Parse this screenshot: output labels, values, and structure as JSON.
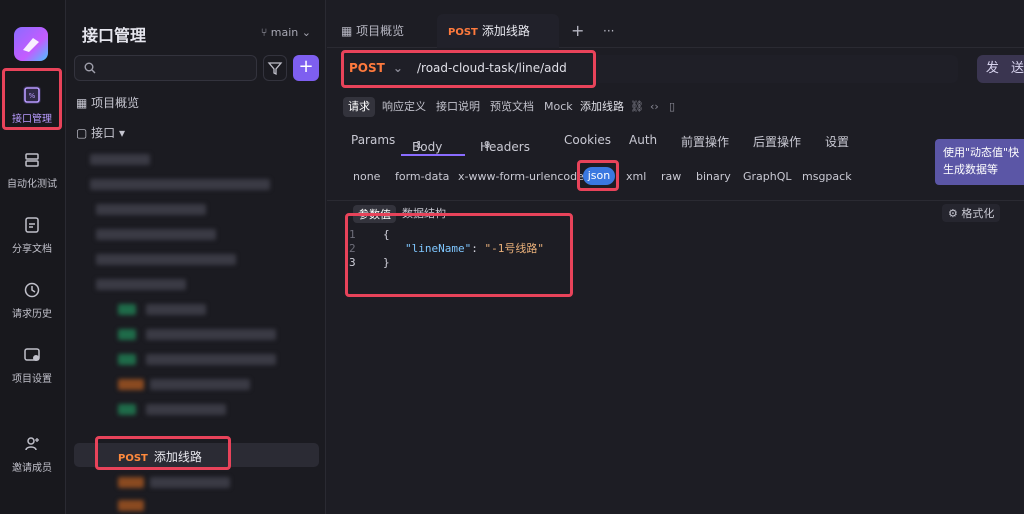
{
  "rail": {
    "items": [
      {
        "label": "接口管理",
        "icon": "api-doc-icon"
      },
      {
        "label": "自动化测试",
        "icon": "automation-icon"
      },
      {
        "label": "分享文档",
        "icon": "share-doc-icon"
      },
      {
        "label": "请求历史",
        "icon": "history-icon"
      },
      {
        "label": "项目设置",
        "icon": "settings-icon"
      },
      {
        "label": "邀请成员",
        "icon": "invite-user-icon"
      }
    ]
  },
  "tree": {
    "title": "接口管理",
    "branch": "main",
    "overview": "项目概览",
    "api_root": "接口",
    "selected": {
      "method": "POST",
      "label": "添加线路"
    }
  },
  "tabs": [
    {
      "label": "项目概览"
    },
    {
      "method": "POST",
      "label": "添加线路"
    }
  ],
  "request": {
    "method": "POST",
    "url": "/road-cloud-task/line/add",
    "send_label": "发 送"
  },
  "subnav": [
    "请求",
    "响应定义",
    "接口说明",
    "预览文档",
    "Mock",
    "添加线路"
  ],
  "req_tabs": [
    {
      "label": "Params"
    },
    {
      "label": "Body",
      "count": "1"
    },
    {
      "label": "Headers",
      "count": "9"
    },
    {
      "label": "Cookies"
    },
    {
      "label": "Auth"
    },
    {
      "label": "前置操作"
    },
    {
      "label": "后置操作"
    },
    {
      "label": "设置"
    }
  ],
  "body_types": [
    "none",
    "form-data",
    "x-www-form-urlencoded",
    "json",
    "xml",
    "raw",
    "binary",
    "GraphQL",
    "msgpack"
  ],
  "tooltip": "使用\"动态值\"快生成数据等",
  "editor": {
    "tabs": [
      "参数值",
      "数据结构"
    ],
    "format_label": "格式化",
    "lines": [
      {
        "n": "1",
        "text": "{"
      },
      {
        "n": "2",
        "key": "\"lineName\"",
        "colon": ": ",
        "value": "\"-1号线路\""
      },
      {
        "n": "3",
        "text": "}"
      }
    ]
  },
  "colors": {
    "accent": "#8a6cff",
    "post": "#ff7a3d",
    "highlight": "#e8435a",
    "json_pill": "#3a78e0"
  }
}
